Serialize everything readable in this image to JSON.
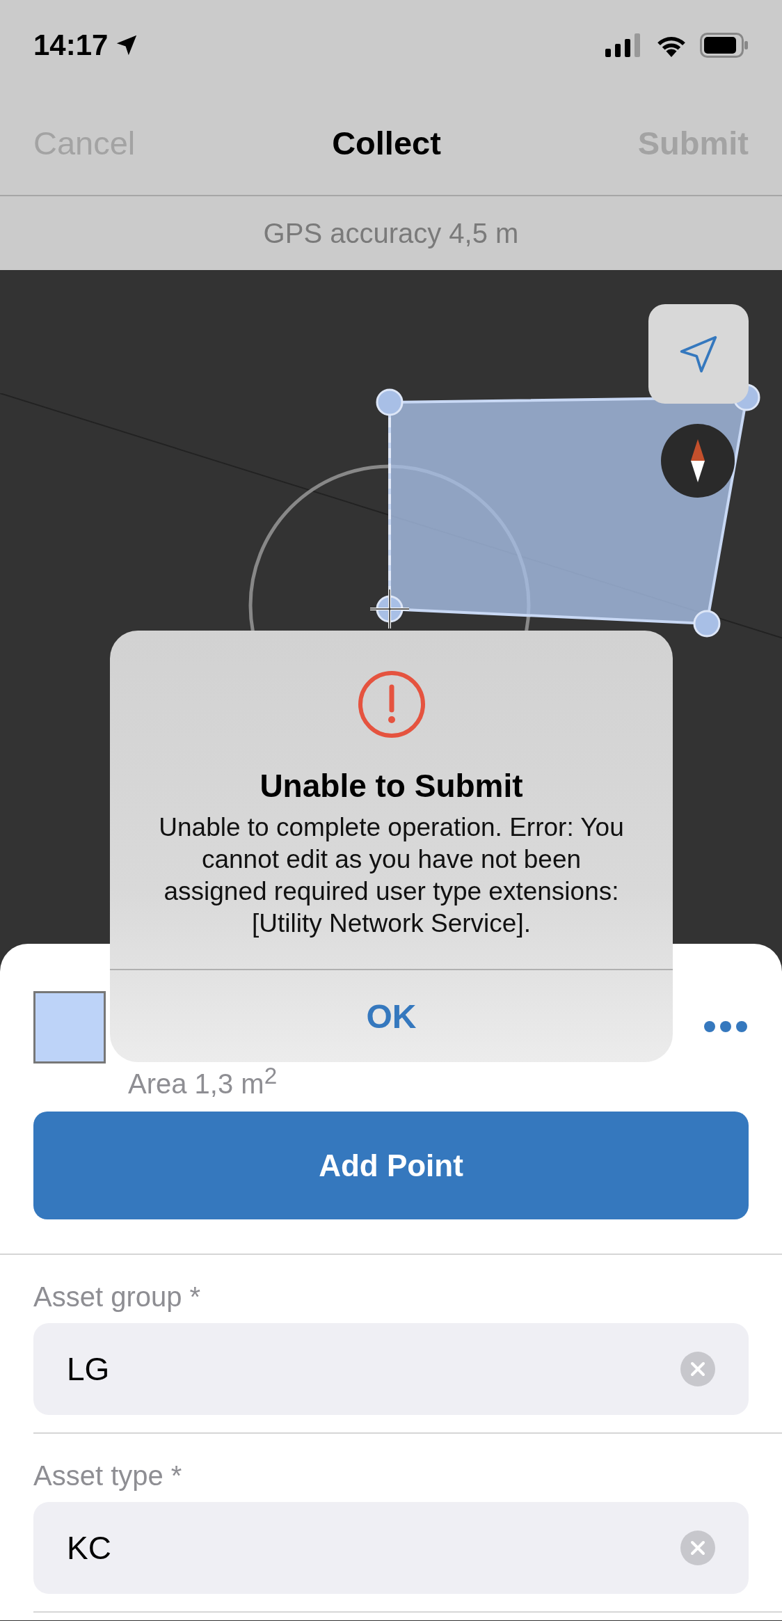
{
  "status_bar": {
    "time": "14:17"
  },
  "nav": {
    "cancel": "Cancel",
    "title": "Collect",
    "submit": "Submit"
  },
  "gps_banner": "GPS accuracy 4,5 m",
  "sheet": {
    "area": "Area 1,3 m$^{2}$",
    "add_button": "Add Point",
    "fields": [
      {
        "label": "Asset group *",
        "value": "LG"
      },
      {
        "label": "Asset type *",
        "value": "KC"
      }
    ]
  },
  "alert": {
    "title": "Unable to Submit",
    "message": "Unable to complete operation. Error: You cannot edit as you have not been assigned required user type extensions: [Utility Network Service].",
    "button": "OK"
  }
}
